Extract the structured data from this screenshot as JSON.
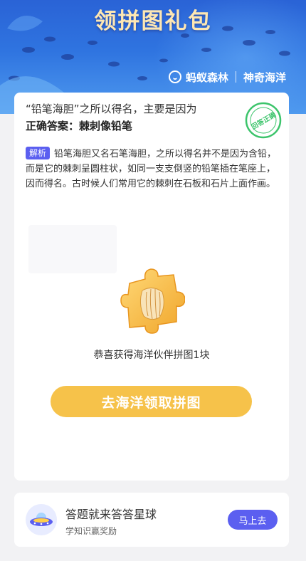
{
  "banner": {
    "title": "领拼图礼包",
    "brand_forest": "蚂蚁森林",
    "brand_ocean": "神奇海洋",
    "brand_icon": "ant-smile-icon"
  },
  "quiz": {
    "question": "“铅笔海胆”之所以得名，主要是因为",
    "answer": "正确答案：棘刺像铅笔",
    "stamp_text": "回答正确",
    "analysis_tag": "解析",
    "analysis_text": "铅笔海胆又名石笔海胆，之所以得名并不是因为含铅，而是它的棘刺呈圆柱状，如同一支支倒竖的铅笔插在笔座上，因而得名。古时候人们常用它的棘刺在石板和石片上面作画。"
  },
  "reward": {
    "congrats": "恭喜获得海洋伙伴拼图1块",
    "claim_label": "去海洋领取拼图",
    "puzzle_icon": "puzzle-piece-icon"
  },
  "promo": {
    "title": "答题就来答答星球",
    "subtitle": "学知识赢奖励",
    "button_label": "马上去",
    "icon": "ufo-icon"
  },
  "colors": {
    "accent": "#5b5ff0",
    "button_yellow": "#f6c24a",
    "banner_blue": "#2f74e0",
    "stamp_green": "#3cc46b"
  }
}
